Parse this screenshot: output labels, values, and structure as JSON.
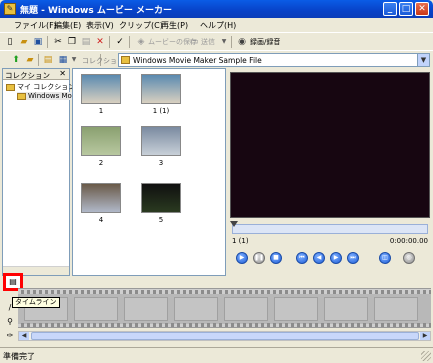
{
  "window": {
    "title": "無題 - Windows ムービー メーカー",
    "min": "_",
    "max": "□",
    "close": "✕"
  },
  "menu": [
    "ファイル(F)",
    "編集(E)",
    "表示(V)",
    "クリップ(C)",
    "再生(P)",
    "ヘルプ(H)"
  ],
  "toolbar": {
    "save_movie": "ムービーの保存",
    "send": "送信",
    "record": "録画/録音"
  },
  "collection_bar": {
    "label": "コレクション",
    "selected": "Windows Movie Maker Sample File"
  },
  "collections_panel": {
    "header": "コレクション",
    "close": "✕",
    "items": [
      "マイ コレクション",
      "Windows Mov"
    ]
  },
  "clips": [
    {
      "label": "1",
      "colors": [
        "#5a8ab0",
        "#d8d0c0"
      ]
    },
    {
      "label": "1 (1)",
      "colors": [
        "#5a8ab0",
        "#d8d0c0"
      ]
    },
    {
      "label": "2",
      "colors": [
        "#8aa070",
        "#b8c8a0"
      ]
    },
    {
      "label": "3",
      "colors": [
        "#7a8aa0",
        "#c8d0d8"
      ]
    },
    {
      "label": "4",
      "colors": [
        "#6a5a48",
        "#b0b8c8"
      ]
    },
    {
      "label": "5",
      "colors": [
        "#101010",
        "#2a3a20"
      ]
    }
  ],
  "monitor": {
    "clip_counter": "1 (1)",
    "time_counter": "0:00:00.00"
  },
  "storyboard": {
    "tooltip": "タイムライン"
  },
  "status": {
    "text": "準備完了"
  },
  "colors": {
    "titlebar": "#0842c8",
    "highlight_border": "#ff0000",
    "monitor_bg": "#170611",
    "button_blue": "#1f5ed8"
  }
}
